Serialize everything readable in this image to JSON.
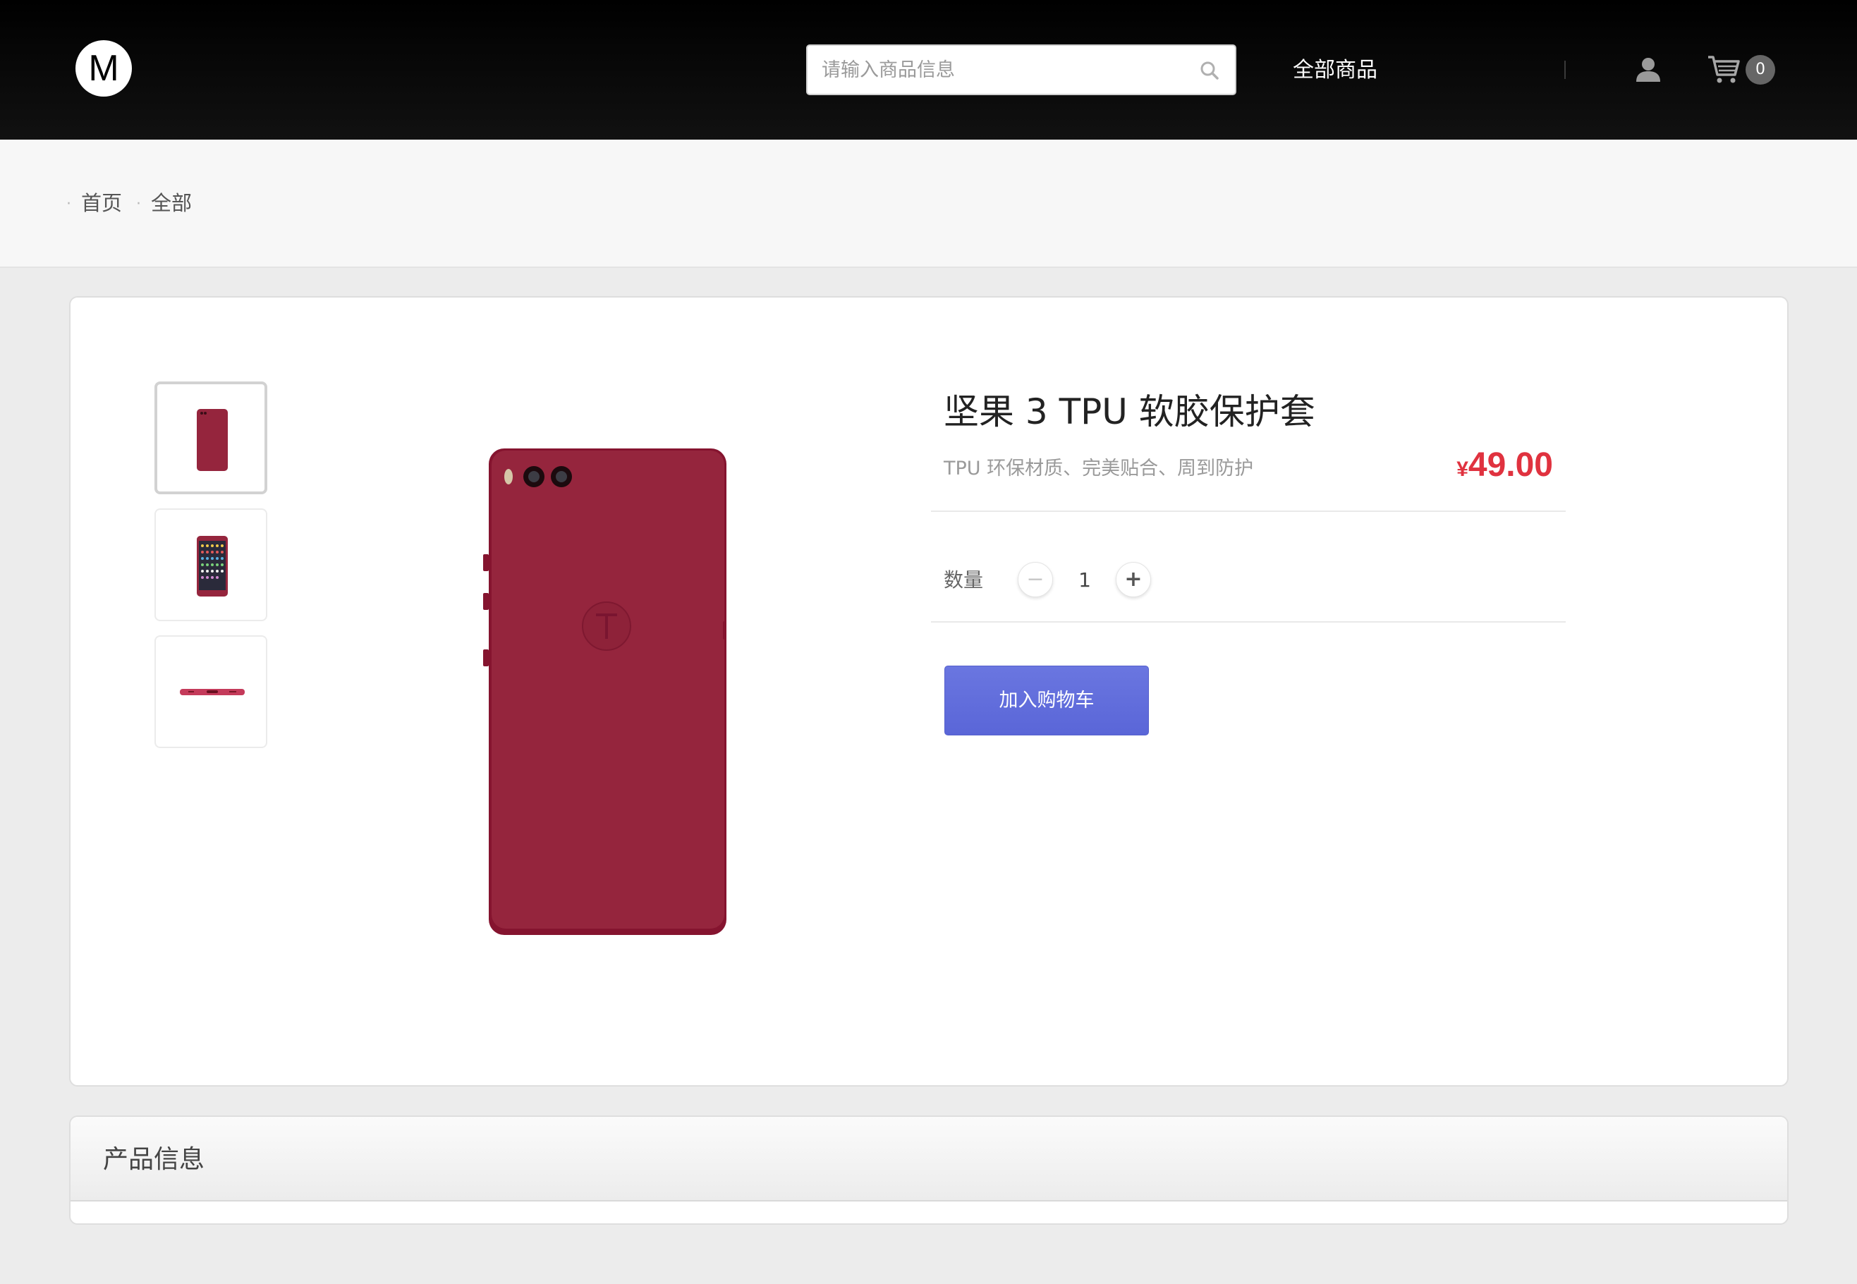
{
  "header": {
    "logo_letter": "M",
    "search_placeholder": "请输入商品信息",
    "nav_all": "全部商品",
    "cart_count": "0"
  },
  "breadcrumb": [
    "首页",
    "全部"
  ],
  "product": {
    "title": "坚果 3 TPU 软胶保护套",
    "subtitle": "TPU 环保材质、完美贴合、周到防护",
    "price_currency": "¥",
    "price_value": "49.00",
    "quantity_label": "数量",
    "quantity_value": "1",
    "minus_symbol": "−",
    "plus_symbol": "+",
    "add_to_cart": "加入购物车",
    "color": "#95253d"
  },
  "info": {
    "title": "产品信息"
  }
}
